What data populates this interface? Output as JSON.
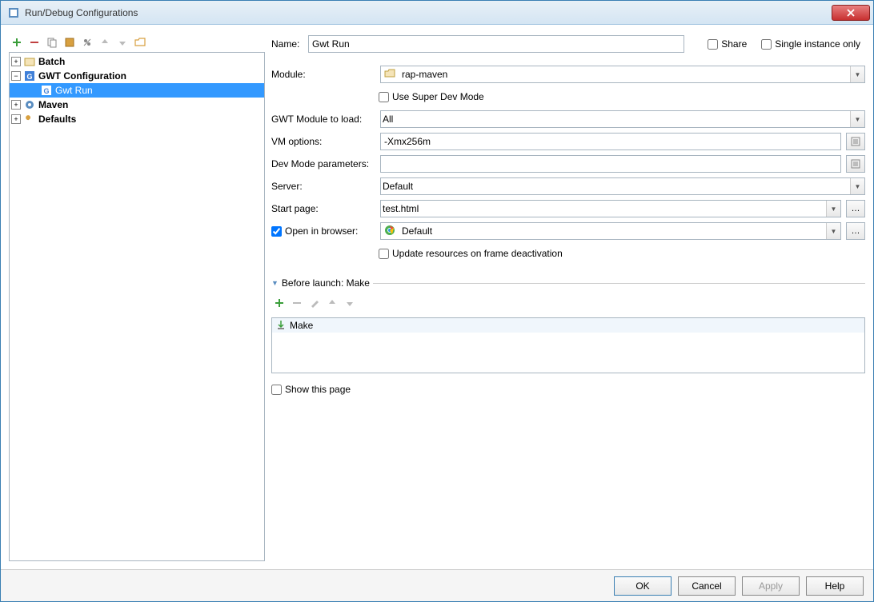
{
  "title": "Run/Debug Configurations",
  "tree": {
    "batch": "Batch",
    "gwt_config": "GWT Configuration",
    "gwt_run": "Gwt Run",
    "maven": "Maven",
    "defaults": "Defaults"
  },
  "form": {
    "name_label": "Name:",
    "name_value": "Gwt Run",
    "share_label": "Share",
    "single_instance_label": "Single instance only",
    "module_label": "Module:",
    "module_value": "rap-maven",
    "super_dev_label": "Use Super Dev Mode",
    "gwt_module_label": "GWT Module to load:",
    "gwt_module_value": "All",
    "vm_label": "VM options:",
    "vm_value": "-Xmx256m",
    "dev_params_label": "Dev Mode parameters:",
    "dev_params_value": "",
    "server_label": "Server:",
    "server_value": "Default",
    "start_page_label": "Start page:",
    "start_page_value": "test.html",
    "open_browser_label": "Open in browser:",
    "open_browser_value": "Default",
    "update_resources_label": "Update resources on frame deactivation",
    "before_launch_label": "Before launch: Make",
    "make_item": "Make",
    "show_page_label": "Show this page"
  },
  "buttons": {
    "ok": "OK",
    "cancel": "Cancel",
    "apply": "Apply",
    "help": "Help"
  }
}
